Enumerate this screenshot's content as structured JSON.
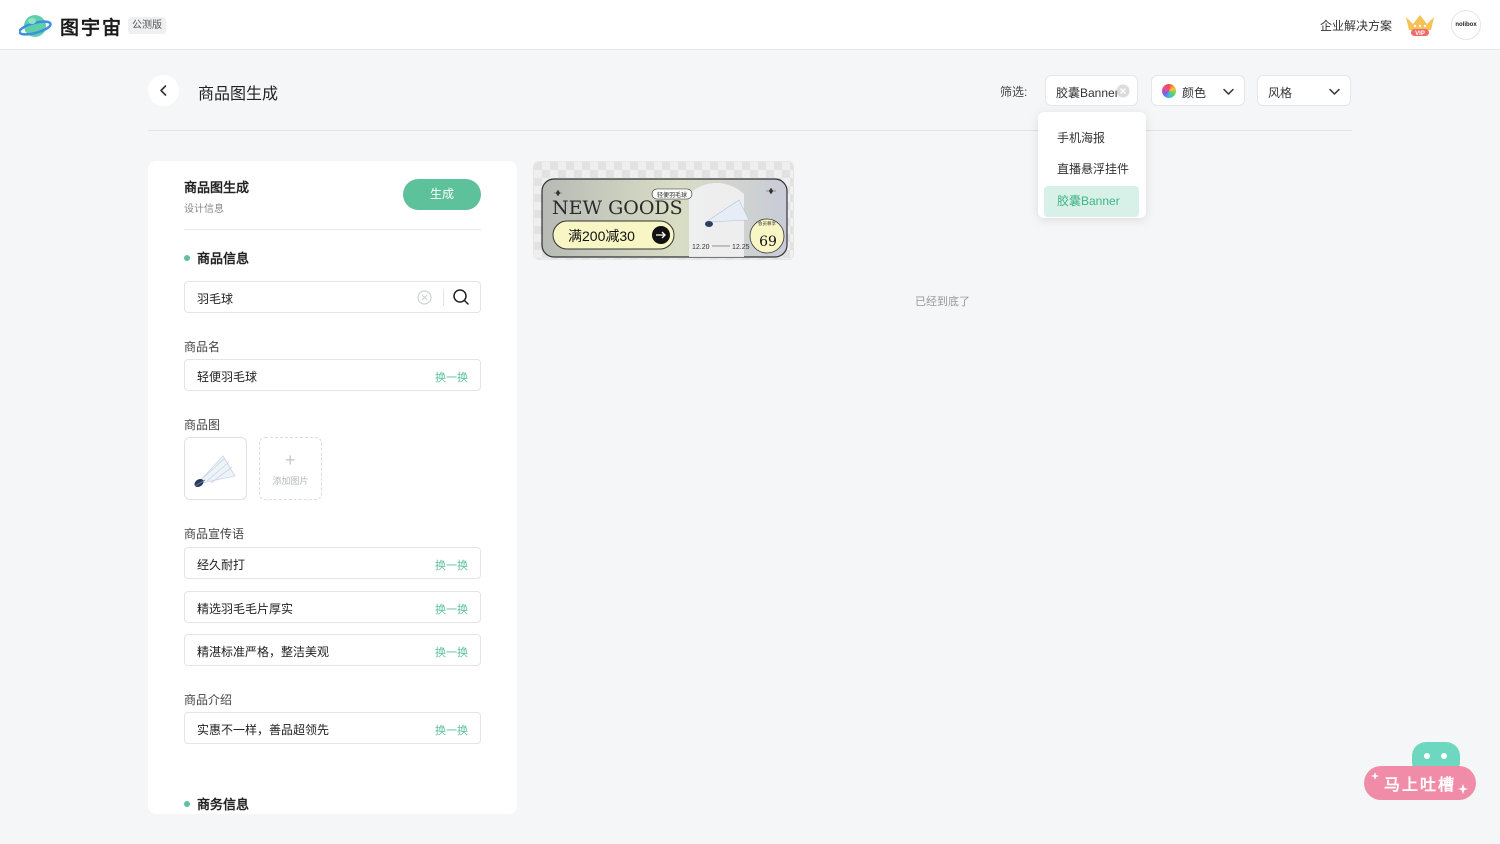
{
  "app": {
    "brand": "图宇宙",
    "beta_badge": "公测版",
    "enterprise_link": "企业解决方案",
    "vip_badge": "VIP",
    "avatar_text": "nolibox"
  },
  "header": {
    "title": "商品图生成",
    "filter_label": "筛选:",
    "filters": {
      "type_selected": "胶囊Banner",
      "color_label": "颜色",
      "style_label": "风格"
    }
  },
  "dropdown": {
    "items": [
      {
        "label": "手机海报",
        "active": false
      },
      {
        "label": "直播悬浮挂件",
        "active": false
      },
      {
        "label": "胶囊Banner",
        "active": true
      }
    ]
  },
  "panel": {
    "title": "商品图生成",
    "subtitle": "设计信息",
    "generate_button": "生成",
    "product_section": "商品信息",
    "search_value": "羽毛球",
    "name_label": "商品名",
    "name_value": "轻便羽毛球",
    "swap_label": "换一换",
    "image_label": "商品图",
    "add_image_label": "添加图片",
    "slogan_label": "商品宣传语",
    "slogans": [
      "经久耐打",
      "精选羽毛毛片厚实",
      "精湛标准严格，整洁美观"
    ],
    "intro_label": "商品介绍",
    "intro_value": "实惠不一样，善品超领先",
    "business_section": "商务信息"
  },
  "banner": {
    "headline": "NEW GOODS",
    "tag": "轻便羽毛球",
    "promo": "满200减30",
    "date_start": "12.20",
    "date_end": "12.25",
    "member_label": "会员尊享",
    "price": "69"
  },
  "results": {
    "end_text": "已经到底了"
  },
  "feedback": {
    "label": "马上吐槽"
  },
  "colors": {
    "accent": "#5dc19c",
    "feedback_pink": "#f08ca8",
    "mascot_teal": "#6ed7c0"
  }
}
